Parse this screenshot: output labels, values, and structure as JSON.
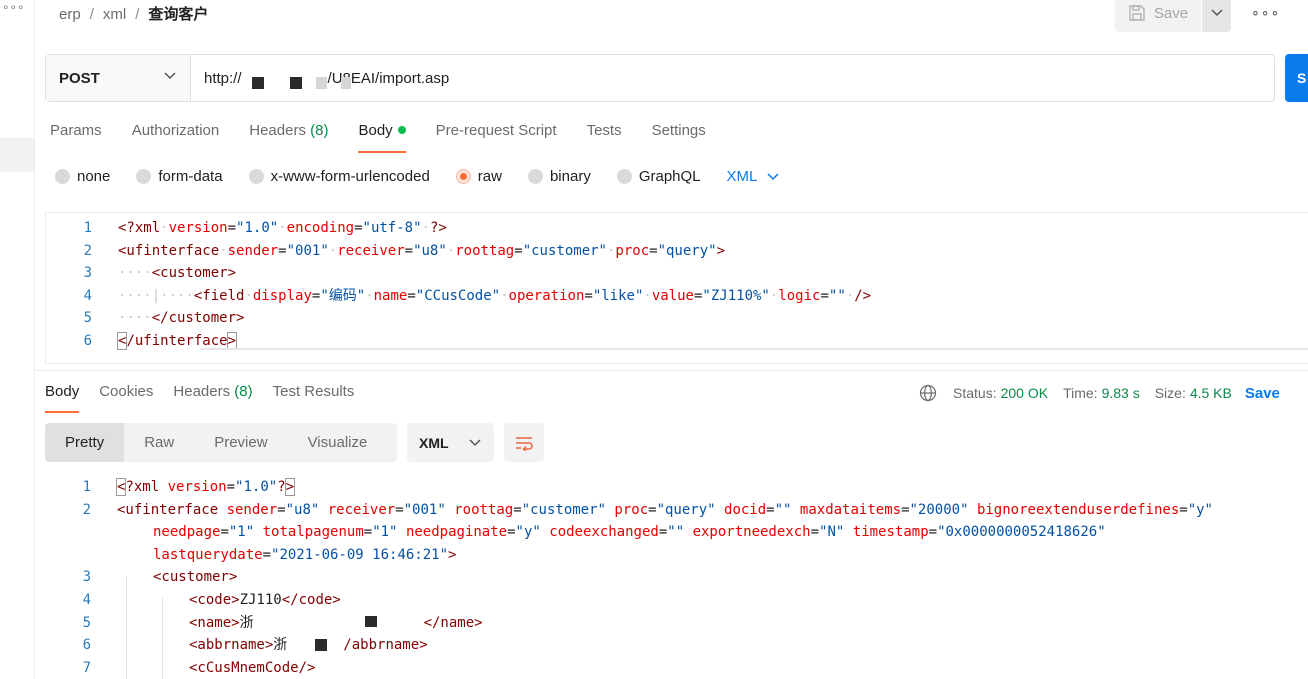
{
  "sidebar": {
    "more_label": "∘∘∘"
  },
  "breadcrumb": [
    "erp",
    "xml",
    "查询客户"
  ],
  "toolbar": {
    "save_label": "Save",
    "more_label": "∘∘∘"
  },
  "request": {
    "method": "POST",
    "url_prefix": "http://",
    "url_suffix": "/U8EAI/import.asp",
    "send_label": "S"
  },
  "request_tabs": [
    {
      "label": "Params"
    },
    {
      "label": "Authorization"
    },
    {
      "label": "Headers",
      "count": "(8)"
    },
    {
      "label": "Body"
    },
    {
      "label": "Pre-request Script"
    },
    {
      "label": "Tests"
    },
    {
      "label": "Settings"
    }
  ],
  "body_types": [
    "none",
    "form-data",
    "x-www-form-urlencoded",
    "raw",
    "binary",
    "GraphQL"
  ],
  "body_format": "XML",
  "request_body_lines": [
    "<?xml version=\"1.0\" encoding=\"utf-8\" ?>",
    "<ufinterface sender=\"001\" receiver=\"u8\" roottag=\"customer\" proc=\"query\">",
    "    <customer>",
    "        <field display=\"编码\" name=\"CCusCode\" operation=\"like\" value=\"ZJ110%\" logic=\"\" />",
    "    </customer>",
    "</ufinterface>"
  ],
  "response_tabs": [
    {
      "label": "Body"
    },
    {
      "label": "Cookies"
    },
    {
      "label": "Headers",
      "count": "(8)"
    },
    {
      "label": "Test Results"
    }
  ],
  "response_stats": {
    "status_label": "Status:",
    "status": "200 OK",
    "time_label": "Time:",
    "time": "9.83 s",
    "size_label": "Size:",
    "size": "4.5 KB",
    "save_label": "Save"
  },
  "view_modes": [
    "Pretty",
    "Raw",
    "Preview",
    "Visualize"
  ],
  "response_format": "XML",
  "response_lines": [
    {
      "n": "1",
      "text": "<?xml version=\"1.0\"?>"
    },
    {
      "n": "2",
      "text": "<ufinterface sender=\"u8\" receiver=\"001\" roottag=\"customer\" proc=\"query\" docid=\"\" maxdataitems=\"20000\" bignoreextenduserdefines=\"y\""
    },
    {
      "n": "",
      "text": "needpage=\"1\" totalpagenum=\"1\" needpaginate=\"y\" codeexchanged=\"\" exportneedexch=\"N\" timestamp=\"0x0000000052418626\""
    },
    {
      "n": "",
      "text": "lastquerydate=\"2021-06-09 16:46:21\">"
    },
    {
      "n": "3",
      "text": "<customer>"
    },
    {
      "n": "4",
      "text": "<code>ZJ110</code>"
    },
    {
      "n": "5",
      "text": "<name>浙</name>"
    },
    {
      "n": "6",
      "text": "<abbrname>浙 /abbrname>"
    },
    {
      "n": "7",
      "text": "<cCusMnemCode/>"
    }
  ],
  "colors": {
    "accent": "#ff6c37",
    "link": "#097bed",
    "success": "#0b8a4a"
  }
}
